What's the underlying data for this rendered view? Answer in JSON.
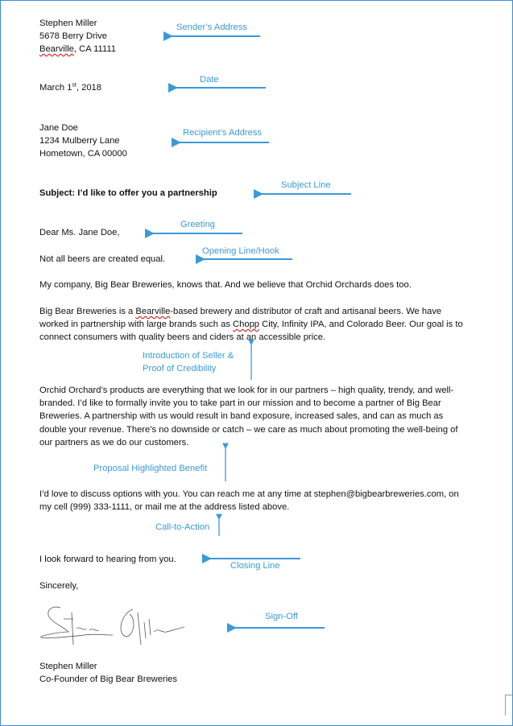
{
  "sender": {
    "name": "Stephen Miller",
    "street": "5678 Berry Drive",
    "city_misspelled": "Bearville",
    "city_rest": ", CA 11111"
  },
  "date": {
    "month_day": "March 1",
    "suffix": "st",
    "year": ", 2018"
  },
  "recipient": {
    "name": "Jane Doe",
    "street": "1234 Mulberry Lane",
    "city": "Hometown,  CA 00000"
  },
  "subject": "Subject: I’d like to offer you a partnership",
  "greeting": "Dear Ms. Jane Doe,",
  "hook": "Not all beers are created equal.",
  "para1": "My company,  Big Bear Breweries, knows that. And we believe that  Orchid Orchards does too.",
  "para2": {
    "line1a": "Big Bear Breweries is a ",
    "line1b": "Bearville",
    "line1c": "-based brewery and distributor of craft and artisanal beers. We have",
    "line2a": "worked in partnership with  large brands such as ",
    "line2b": "Chopp",
    "line2c": " City,  Infinity IPA, and Colorado Beer. Our goal is to",
    "line3": "connect consumers with quality beers and ciders at an accessible price."
  },
  "para3": [
    "Orchid Orchard’s products are everything that we look for in our partners – high quality, trendy, and well-",
    "branded. I’d like to formally invite you to take part in our mission and to become a partner of Big Bear",
    "Breweries. A partnership with us would result in band exposure, increased sales, and can as much as",
    "double your revenue. There’s no downside or catch – we care as much about promoting the well-being of",
    "our partners as we  do our customers."
  ],
  "para4": [
    "I’d love to discuss options with you. You can reach me at any time  at stephen@bigbearbreweries.com, on",
    "my cell (999) 333-1111, or mail me at the address listed above."
  ],
  "closing": "I look forward to hearing from you.",
  "signoff": "Sincerely,",
  "signature_text": "Stephen Miller",
  "signer": {
    "name": "Stephen Miller",
    "title": "Co-Founder of Big Bear Breweries"
  },
  "annotations": {
    "sender": "Sender’s Address",
    "date": "Date",
    "recipient": "Recipient’s Address",
    "subject": "Subject Line",
    "greeting": "Greeting",
    "hook": "Opening Line/Hook",
    "intro1": "Introduction of Seller &",
    "intro2": "Proof of Credibility",
    "proposal": "Proposal Highlighted  Benefit",
    "cta": "Call-to-Action",
    "closing": "Closing Line",
    "signoff": "Sign-Off"
  },
  "colors": {
    "annotation": "#3a9ad9",
    "border": "#3a8fd0",
    "spellcheck": "#dd0000"
  }
}
